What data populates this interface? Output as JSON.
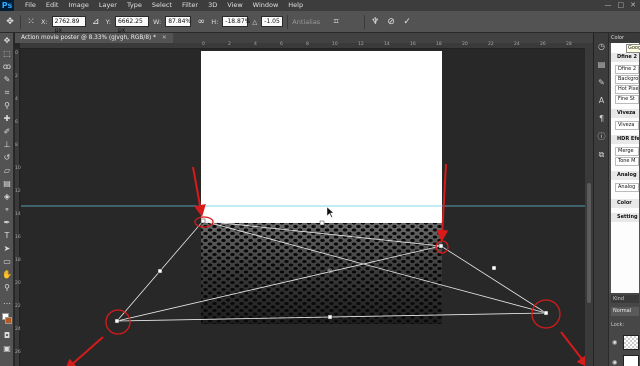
{
  "app": {
    "logo": "Ps",
    "menu": [
      "File",
      "Edit",
      "Image",
      "Layer",
      "Type",
      "Select",
      "Filter",
      "3D",
      "View",
      "Window",
      "Help"
    ],
    "window_controls": [
      "—",
      "□",
      "✕"
    ]
  },
  "options_bar": {
    "x_label": "X:",
    "x_value": "2762.89 px",
    "y_label": "Y:",
    "y_value": "6662.25 px",
    "w_label": "W:",
    "w_value": "87.84%",
    "h_label": "H:",
    "h_value": "-18.87%",
    "angle_label": "△",
    "angle_value": "-1.05",
    "interp_value": "Antialias",
    "icons": [
      "move-tool-icon",
      "reference-point-icon",
      "link-icon",
      "warp-icon",
      "cancel-icon",
      "commit-icon"
    ]
  },
  "document": {
    "tab_title": "Action movie poster @ 8.33% (gjvgh, RGB/8) *",
    "ruler_h_ticks": [
      "0",
      "2",
      "4",
      "6",
      "8",
      "10",
      "12",
      "14",
      "16",
      "18",
      "20",
      "22",
      "24",
      "26",
      "28"
    ],
    "ruler_v_ticks": [
      "0",
      "2",
      "4",
      "6",
      "8",
      "10",
      "12",
      "14",
      "16",
      "18",
      "20",
      "22",
      "24",
      "26"
    ]
  },
  "right_panel": {
    "tabs_label": "Color",
    "tooltip": "Google",
    "list_items": [
      {
        "text": "Dfine 2",
        "kind": "head"
      },
      {
        "text": "Dfine 2",
        "kind": "item"
      },
      {
        "text": "Background",
        "kind": "item"
      },
      {
        "text": "Hot Pixel",
        "kind": "item"
      },
      {
        "text": "Fine St",
        "kind": "item"
      },
      {
        "text": "Viveza",
        "kind": "head"
      },
      {
        "text": "Viveza",
        "kind": "item"
      },
      {
        "text": "HDR Efex",
        "kind": "head"
      },
      {
        "text": "Merge",
        "kind": "item"
      },
      {
        "text": "Tone M",
        "kind": "item"
      },
      {
        "text": "Analog",
        "kind": "head"
      },
      {
        "text": "Analog",
        "kind": "item"
      },
      {
        "text": "Color",
        "kind": "head"
      },
      {
        "text": "Setting",
        "kind": "head"
      }
    ],
    "layers": {
      "kind_label": "Kind",
      "blend_mode": "Normal",
      "lock_label": "Lock:"
    }
  },
  "colors": {
    "accent_red": "#d71a1a",
    "guide": "#62c6e6",
    "brand": "#31a8ff"
  }
}
